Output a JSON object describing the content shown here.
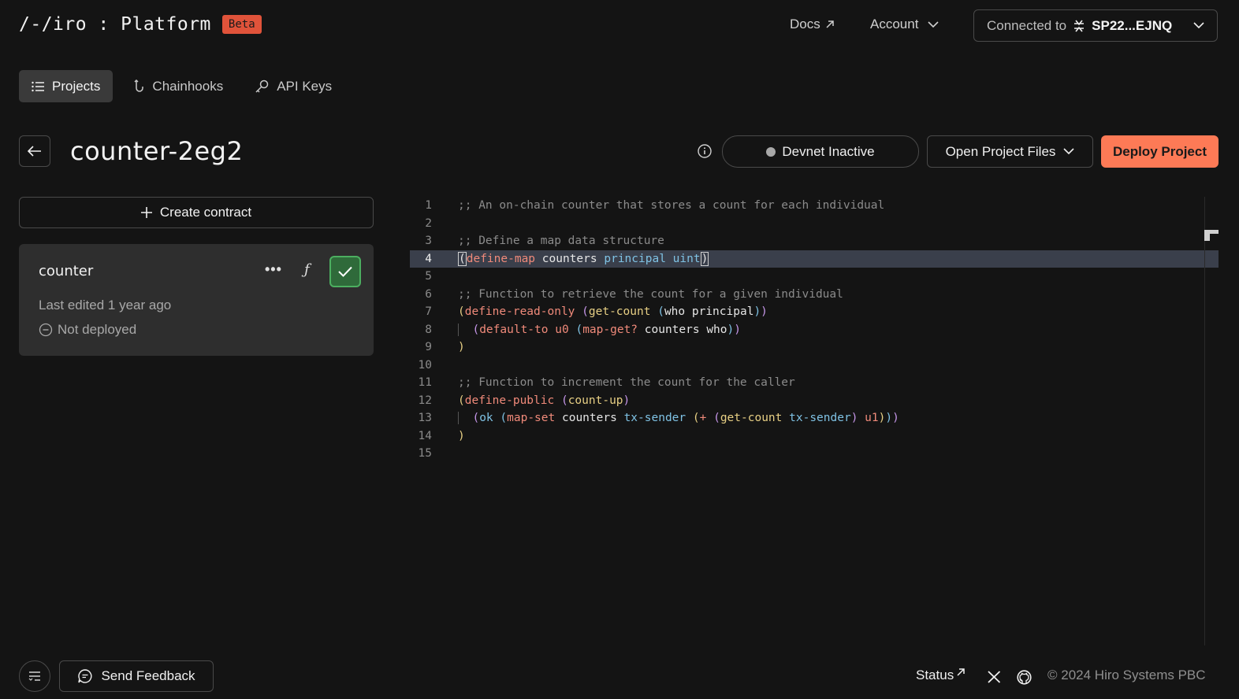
{
  "header": {
    "logo_text": "/-/iro : Platform",
    "beta_label": "Beta",
    "docs_label": "Docs",
    "account_label": "Account",
    "connected_label": "Connected to",
    "wallet_address": "SP22...EJNQ"
  },
  "tabs": [
    {
      "label": "Projects",
      "icon": "list-icon",
      "active": true
    },
    {
      "label": "Chainhooks",
      "icon": "hook-icon",
      "active": false
    },
    {
      "label": "API Keys",
      "icon": "key-icon",
      "active": false
    }
  ],
  "project": {
    "title": "counter-2eg2",
    "devnet_status": "Devnet Inactive",
    "open_files_label": "Open Project Files",
    "deploy_label": "Deploy Project"
  },
  "sidebar": {
    "create_label": "Create contract",
    "contract": {
      "name": "counter",
      "more_label": "•••",
      "fn_label": "ƒ",
      "edited": "Last edited 1 year ago",
      "status": "Not deployed"
    }
  },
  "editor": {
    "current_line": 4,
    "line_numbers": [
      "1",
      "2",
      "3",
      "4",
      "5",
      "6",
      "7",
      "8",
      "9",
      "10",
      "11",
      "12",
      "13",
      "14",
      "15"
    ]
  },
  "footer": {
    "feedback_label": "Send Feedback",
    "status_label": "Status",
    "copyright": "© 2024 Hiro Systems PBC"
  },
  "colors": {
    "accent": "#fd7a56",
    "beta_bg": "#e0533a",
    "success": "#4caf60",
    "background": "#141414"
  }
}
